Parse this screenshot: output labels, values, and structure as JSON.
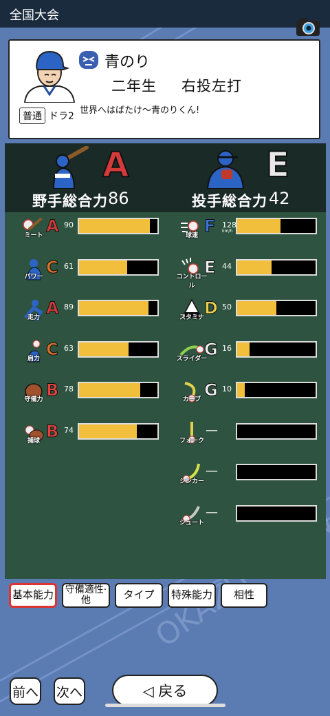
{
  "header": {
    "title": "全国大会",
    "camera_icon": "camera-icon"
  },
  "player": {
    "name": "青のり",
    "mood_icon": "mood-face-icon",
    "grade": "二年生",
    "hand": "右投左打",
    "badge": "普通",
    "draft": "ドラ2",
    "comment": "世界へはばたけ～青のりくん!"
  },
  "overall": {
    "fielder": {
      "label": "野手総合力",
      "rank": "A",
      "value": "86"
    },
    "pitcher": {
      "label": "投手総合力",
      "rank": "E",
      "value": "42"
    }
  },
  "fielder_stats": [
    {
      "label": "ミート",
      "grade": "A",
      "value": "90",
      "level": 90,
      "color": "#d33a3a",
      "icon": "meet-icon"
    },
    {
      "label": "パワー",
      "grade": "C",
      "value": "61",
      "level": 61,
      "color": "#d9702a",
      "icon": "power-icon"
    },
    {
      "label": "走力",
      "grade": "A",
      "value": "89",
      "level": 89,
      "color": "#d33a3a",
      "icon": "speed-icon"
    },
    {
      "label": "肩力",
      "grade": "C",
      "value": "63",
      "level": 63,
      "color": "#d9702a",
      "icon": "arm-icon"
    },
    {
      "label": "守備力",
      "grade": "B",
      "value": "78",
      "level": 78,
      "color": "#e0423d",
      "icon": "glove-icon"
    },
    {
      "label": "捕球",
      "grade": "B",
      "value": "74",
      "level": 74,
      "color": "#e0423d",
      "icon": "catch-icon"
    }
  ],
  "pitcher_stats": [
    {
      "label": "球速",
      "grade": "F",
      "value": "128",
      "unit": "km/h",
      "level": 55,
      "color": "#3b73d6",
      "icon": "velocity-icon"
    },
    {
      "label": "コントロール",
      "grade": "E",
      "value": "44",
      "level": 44,
      "color": "#eeeeee",
      "icon": "control-icon"
    },
    {
      "label": "スタミナ",
      "grade": "D",
      "value": "50",
      "level": 50,
      "color": "#e9cf4b",
      "icon": "stamina-icon"
    },
    {
      "label": "スライダー",
      "grade": "G",
      "value": "16",
      "level": 16,
      "color": "#eeeeee",
      "icon": "slider-icon"
    },
    {
      "label": "カーブ",
      "grade": "G",
      "value": "10",
      "level": 10,
      "color": "#eeeeee",
      "icon": "curve-icon"
    },
    {
      "label": "フォーク",
      "grade": "",
      "value": "—",
      "level": 0,
      "color": "#eeeeee",
      "icon": "fork-icon"
    },
    {
      "label": "シンカー",
      "grade": "",
      "value": "—",
      "level": 0,
      "color": "#eeeeee",
      "icon": "sinker-icon"
    },
    {
      "label": "シュート",
      "grade": "",
      "value": "—",
      "level": 0,
      "color": "#eeeeee",
      "icon": "shoot-icon"
    }
  ],
  "tabs": [
    "基本能力",
    "守備適性·他",
    "タイプ",
    "特殊能力",
    "相性"
  ],
  "footer": {
    "prev": "前へ",
    "next": "次へ",
    "back": "◁ 戻る"
  },
  "watermark": "OKAZU REQWA"
}
